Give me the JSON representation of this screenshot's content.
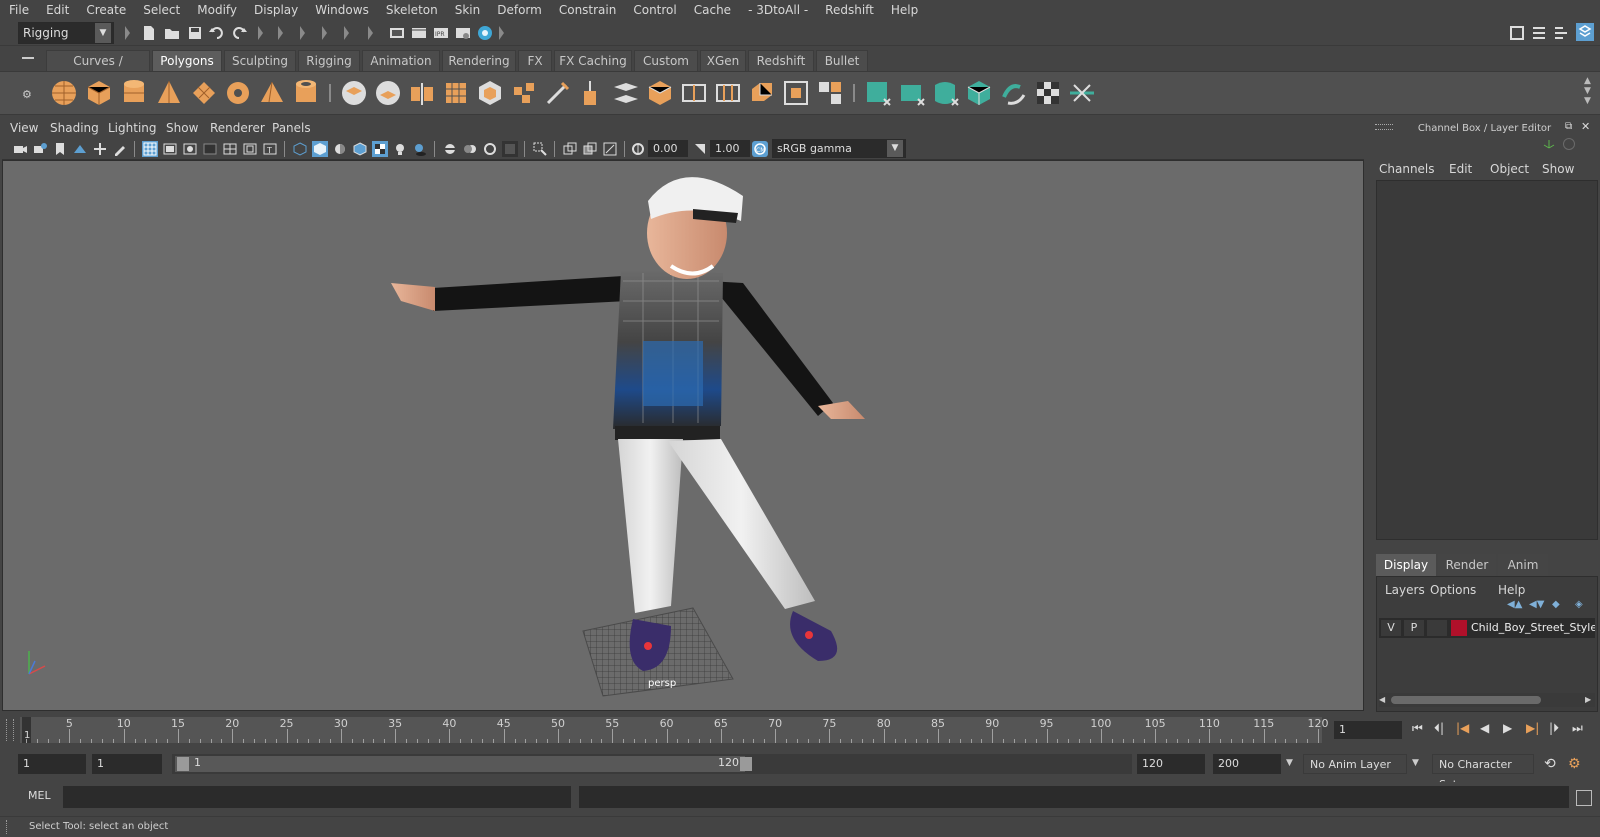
{
  "menubar": {
    "items": [
      "File",
      "Edit",
      "Create",
      "Select",
      "Modify",
      "Display",
      "Windows",
      "Skeleton",
      "Skin",
      "Deform",
      "Constrain",
      "Control",
      "Cache",
      "- 3DtoAll -",
      "Redshift",
      "Help"
    ]
  },
  "statusline": {
    "menuset": "Rigging"
  },
  "shelf": {
    "tabs": [
      "Curves / Surfaces",
      "Polygons",
      "Sculpting",
      "Rigging",
      "Animation",
      "Rendering",
      "FX",
      "FX Caching",
      "Custom",
      "XGen",
      "Redshift",
      "Bullet"
    ],
    "active_tab": "Polygons"
  },
  "viewport": {
    "menu": [
      "View",
      "Shading",
      "Lighting",
      "Show",
      "Renderer",
      "Panels"
    ],
    "exposure": "0.00",
    "gamma": "1.00",
    "color_space": "sRGB gamma",
    "camera_label": "persp"
  },
  "channelbox": {
    "title": "Channel Box / Layer Editor",
    "menu": [
      "Channels",
      "Edit",
      "Object",
      "Show"
    ]
  },
  "layereditor": {
    "tabs": [
      "Display",
      "Render",
      "Anim"
    ],
    "active_tab": "Display",
    "menu": [
      "Layers",
      "Options",
      "Help"
    ],
    "layer": {
      "visible": "V",
      "playback": "P",
      "name": "Child_Boy_Street_Style_P",
      "color": "#b0102a"
    }
  },
  "timeline": {
    "start_marker": "1",
    "ticks": [
      "5",
      "10",
      "15",
      "20",
      "25",
      "30",
      "35",
      "40",
      "45",
      "50",
      "55",
      "60",
      "65",
      "70",
      "75",
      "80",
      "85",
      "90",
      "95",
      "100",
      "105",
      "110",
      "115",
      "120"
    ],
    "current_frame": "1"
  },
  "range": {
    "start": "1",
    "playback_start": "1",
    "slider_start": "1",
    "slider_end": "120",
    "playback_end": "120",
    "end": "200",
    "anim_layer": "No Anim Layer",
    "character_set": "No Character Set"
  },
  "commandline": {
    "label": "MEL"
  },
  "helpline": {
    "text": "Select Tool: select an object"
  },
  "colors": {
    "accent": "#5d9fd1",
    "shelf_orange": "#e8a05a",
    "shelf_teal": "#3fae9c",
    "layer_red": "#b0102a"
  }
}
